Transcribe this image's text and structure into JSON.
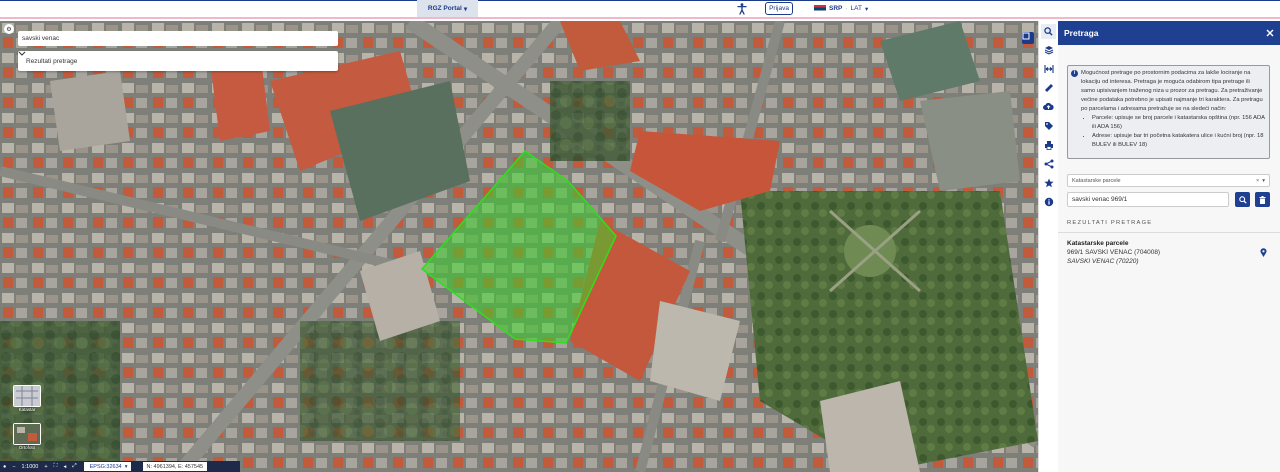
{
  "topbar": {
    "portal_label": "RGZ Portal",
    "login_label": "Prijava",
    "lang_primary": "SRP",
    "lang_alt": "LAT",
    "accessibility_icon": "accessibility-icon"
  },
  "map": {
    "search_value": "savski venac",
    "results_dropdown": "Rezultati pretrage",
    "layers": [
      {
        "label": "Katastar"
      },
      {
        "label": "Ortofoto"
      }
    ],
    "scale": "1:1000",
    "epsg": "EPSG:32634",
    "coords": "N: 4961394, E: 457545",
    "parcel_color": "#3dd12a"
  },
  "toolbar": {
    "items": [
      "search-icon",
      "layers-icon",
      "measure-width-icon",
      "ruler-icon",
      "cloud-upload-icon",
      "tags-icon",
      "print-icon",
      "share-icon",
      "star-icon",
      "info-icon"
    ]
  },
  "panel": {
    "title": "Pretraga",
    "info_text": "Mogućnost pretrage po prostornim podacima za lakše lociranje na lokaciju od interesa. Pretraga je moguća odabirom tipa pretrage ili samo upisivanjem traženog niza u prozor za pretragu. Za pretraživanje većine podataka potrebno je upisati najmanje tri karaktera. Za pretragu po parcelama i adresama pretražuje se na sledeći način:",
    "bullets": [
      "Parcele: upisuje se broj parcele i katastarska opština (npr. 156 ADA ili ADA 156)",
      "Adrese: upisuje bar tri početna katakatera ulice i kućni broj (npr. 18 BULEV ili BULEV 18)"
    ],
    "search_type": "Katastarske parcele",
    "query": "savski venac 969/1",
    "results_header": "REZULTATI PRETRAGE",
    "result": {
      "title": "Katastarske parcele",
      "line": "969/1 SAVSKI VENAC (704008)",
      "sub": "SAVSKI VENAC (70220)"
    },
    "accent": "#1f3f91"
  }
}
